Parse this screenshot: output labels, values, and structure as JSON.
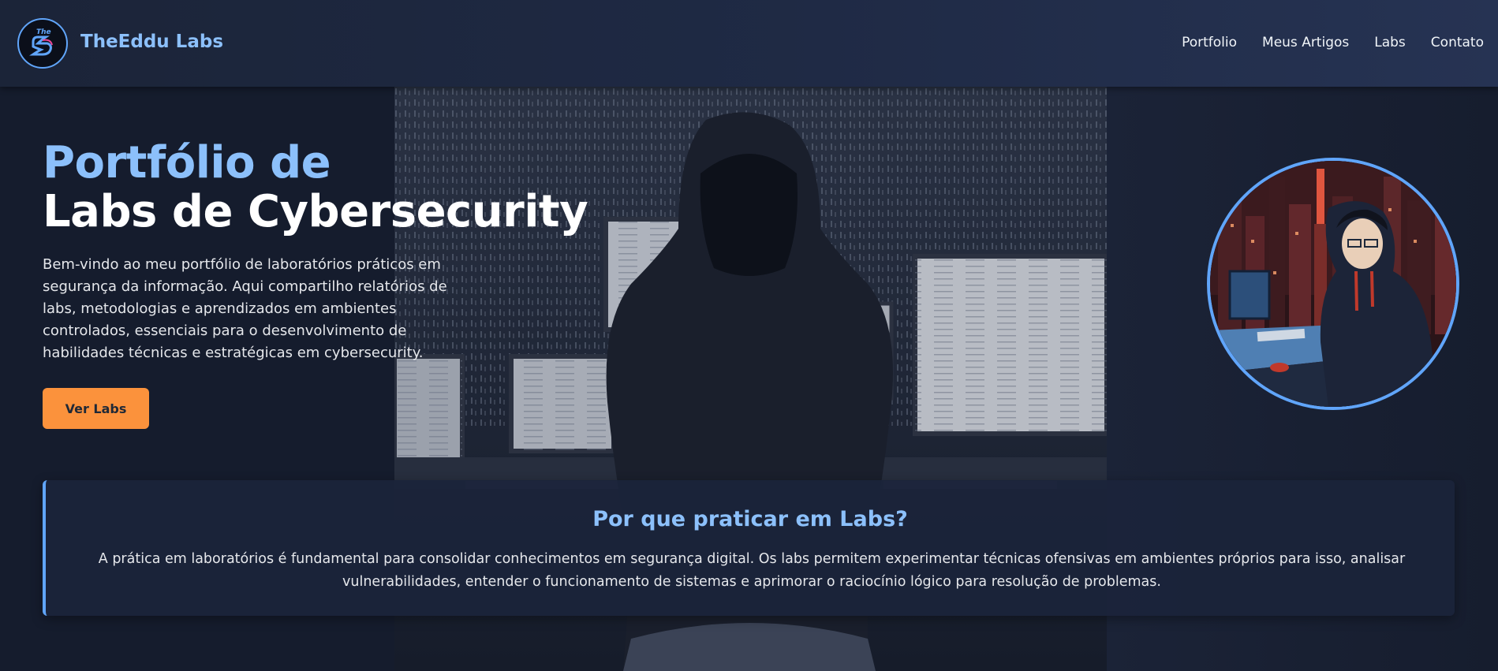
{
  "brand": {
    "logo_text": "The",
    "name": "TheEddu Labs"
  },
  "nav": {
    "items": [
      "Portfolio",
      "Meus Artigos",
      "Labs",
      "Contato"
    ]
  },
  "hero": {
    "title_line1": "Portfólio de",
    "title_line2": "Labs de Cybersecurity",
    "description": "Bem-vindo ao meu portfólio de laboratórios práticos em segurança da informação. Aqui compartilho relatórios de labs, metodologias e aprendizados em ambientes controlados, essenciais para o desenvolvimento de habilidades técnicas e estratégicas em cybersecurity.",
    "cta_label": "Ver Labs"
  },
  "info": {
    "title": "Por que praticar em Labs?",
    "text": "A prática em laboratórios é fundamental para consolidar conhecimentos em segurança digital. Os labs permitem experimentar técnicas ofensivas em ambientes próprios para isso, analisar vulnerabilidades, entender o funcionamento de sistemas e aprimorar o raciocínio lógico para resolução de problemas."
  },
  "colors": {
    "accent": "#60a5fa",
    "title_blue": "#8cc0fb",
    "cta": "#fb923c",
    "background": "#141c2e"
  }
}
